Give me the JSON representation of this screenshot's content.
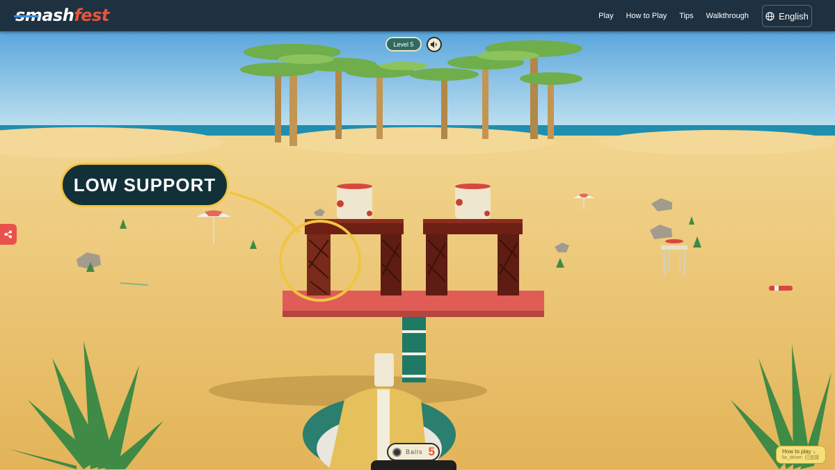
{
  "brand": {
    "logo_text_a": "smash",
    "logo_text_b": "fest"
  },
  "nav": {
    "items": [
      "Play",
      "How to Play",
      "Tips",
      "Walkthrough"
    ]
  },
  "language": {
    "label": "English"
  },
  "hud": {
    "level_label": "Level 5",
    "balls_label": "Balls",
    "balls_count": "5"
  },
  "callout": {
    "text": "LOW SUPPORT"
  },
  "howto_widget": {
    "label": "How to play ↓",
    "sub": "lio_driver: 已连接"
  },
  "colors": {
    "header_bg": "#1e3140",
    "accent": "#e8543a",
    "callout_border": "#f0c540",
    "level_pill": "#2f6b62"
  },
  "icons": [
    "globe-icon",
    "sound-icon",
    "share-icon",
    "ball-icon"
  ]
}
